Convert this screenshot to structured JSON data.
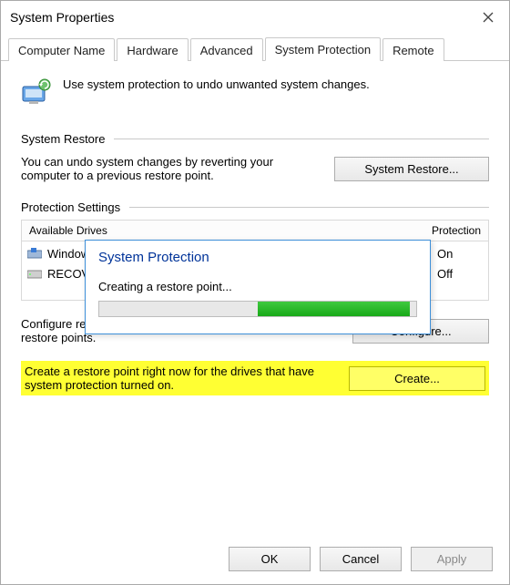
{
  "window": {
    "title": "System Properties"
  },
  "tabs": [
    "Computer Name",
    "Hardware",
    "Advanced",
    "System Protection",
    "Remote"
  ],
  "active_tab_index": 3,
  "info_text": "Use system protection to undo unwanted system changes.",
  "section_restore": {
    "title": "System Restore",
    "desc": "You can undo system changes by reverting your computer to a previous restore point.",
    "button": "System Restore..."
  },
  "section_protection": {
    "title": "Protection Settings",
    "col_drive": "Available Drives",
    "col_status": "Protection",
    "drives": [
      {
        "name": "Windows (C:) (System)",
        "status": "On",
        "icon": "disk-sys"
      },
      {
        "name": "RECOVERY (D:)",
        "status": "Off",
        "icon": "disk"
      }
    ]
  },
  "configure": {
    "desc": "Configure restore settings, manage disk space, and delete restore points.",
    "button": "Configure..."
  },
  "create": {
    "desc": "Create a restore point right now for the drives that have system protection turned on.",
    "button": "Create..."
  },
  "progress_dialog": {
    "title": "System Protection",
    "message": "Creating a restore point..."
  },
  "buttons": {
    "ok": "OK",
    "cancel": "Cancel",
    "apply": "Apply"
  }
}
